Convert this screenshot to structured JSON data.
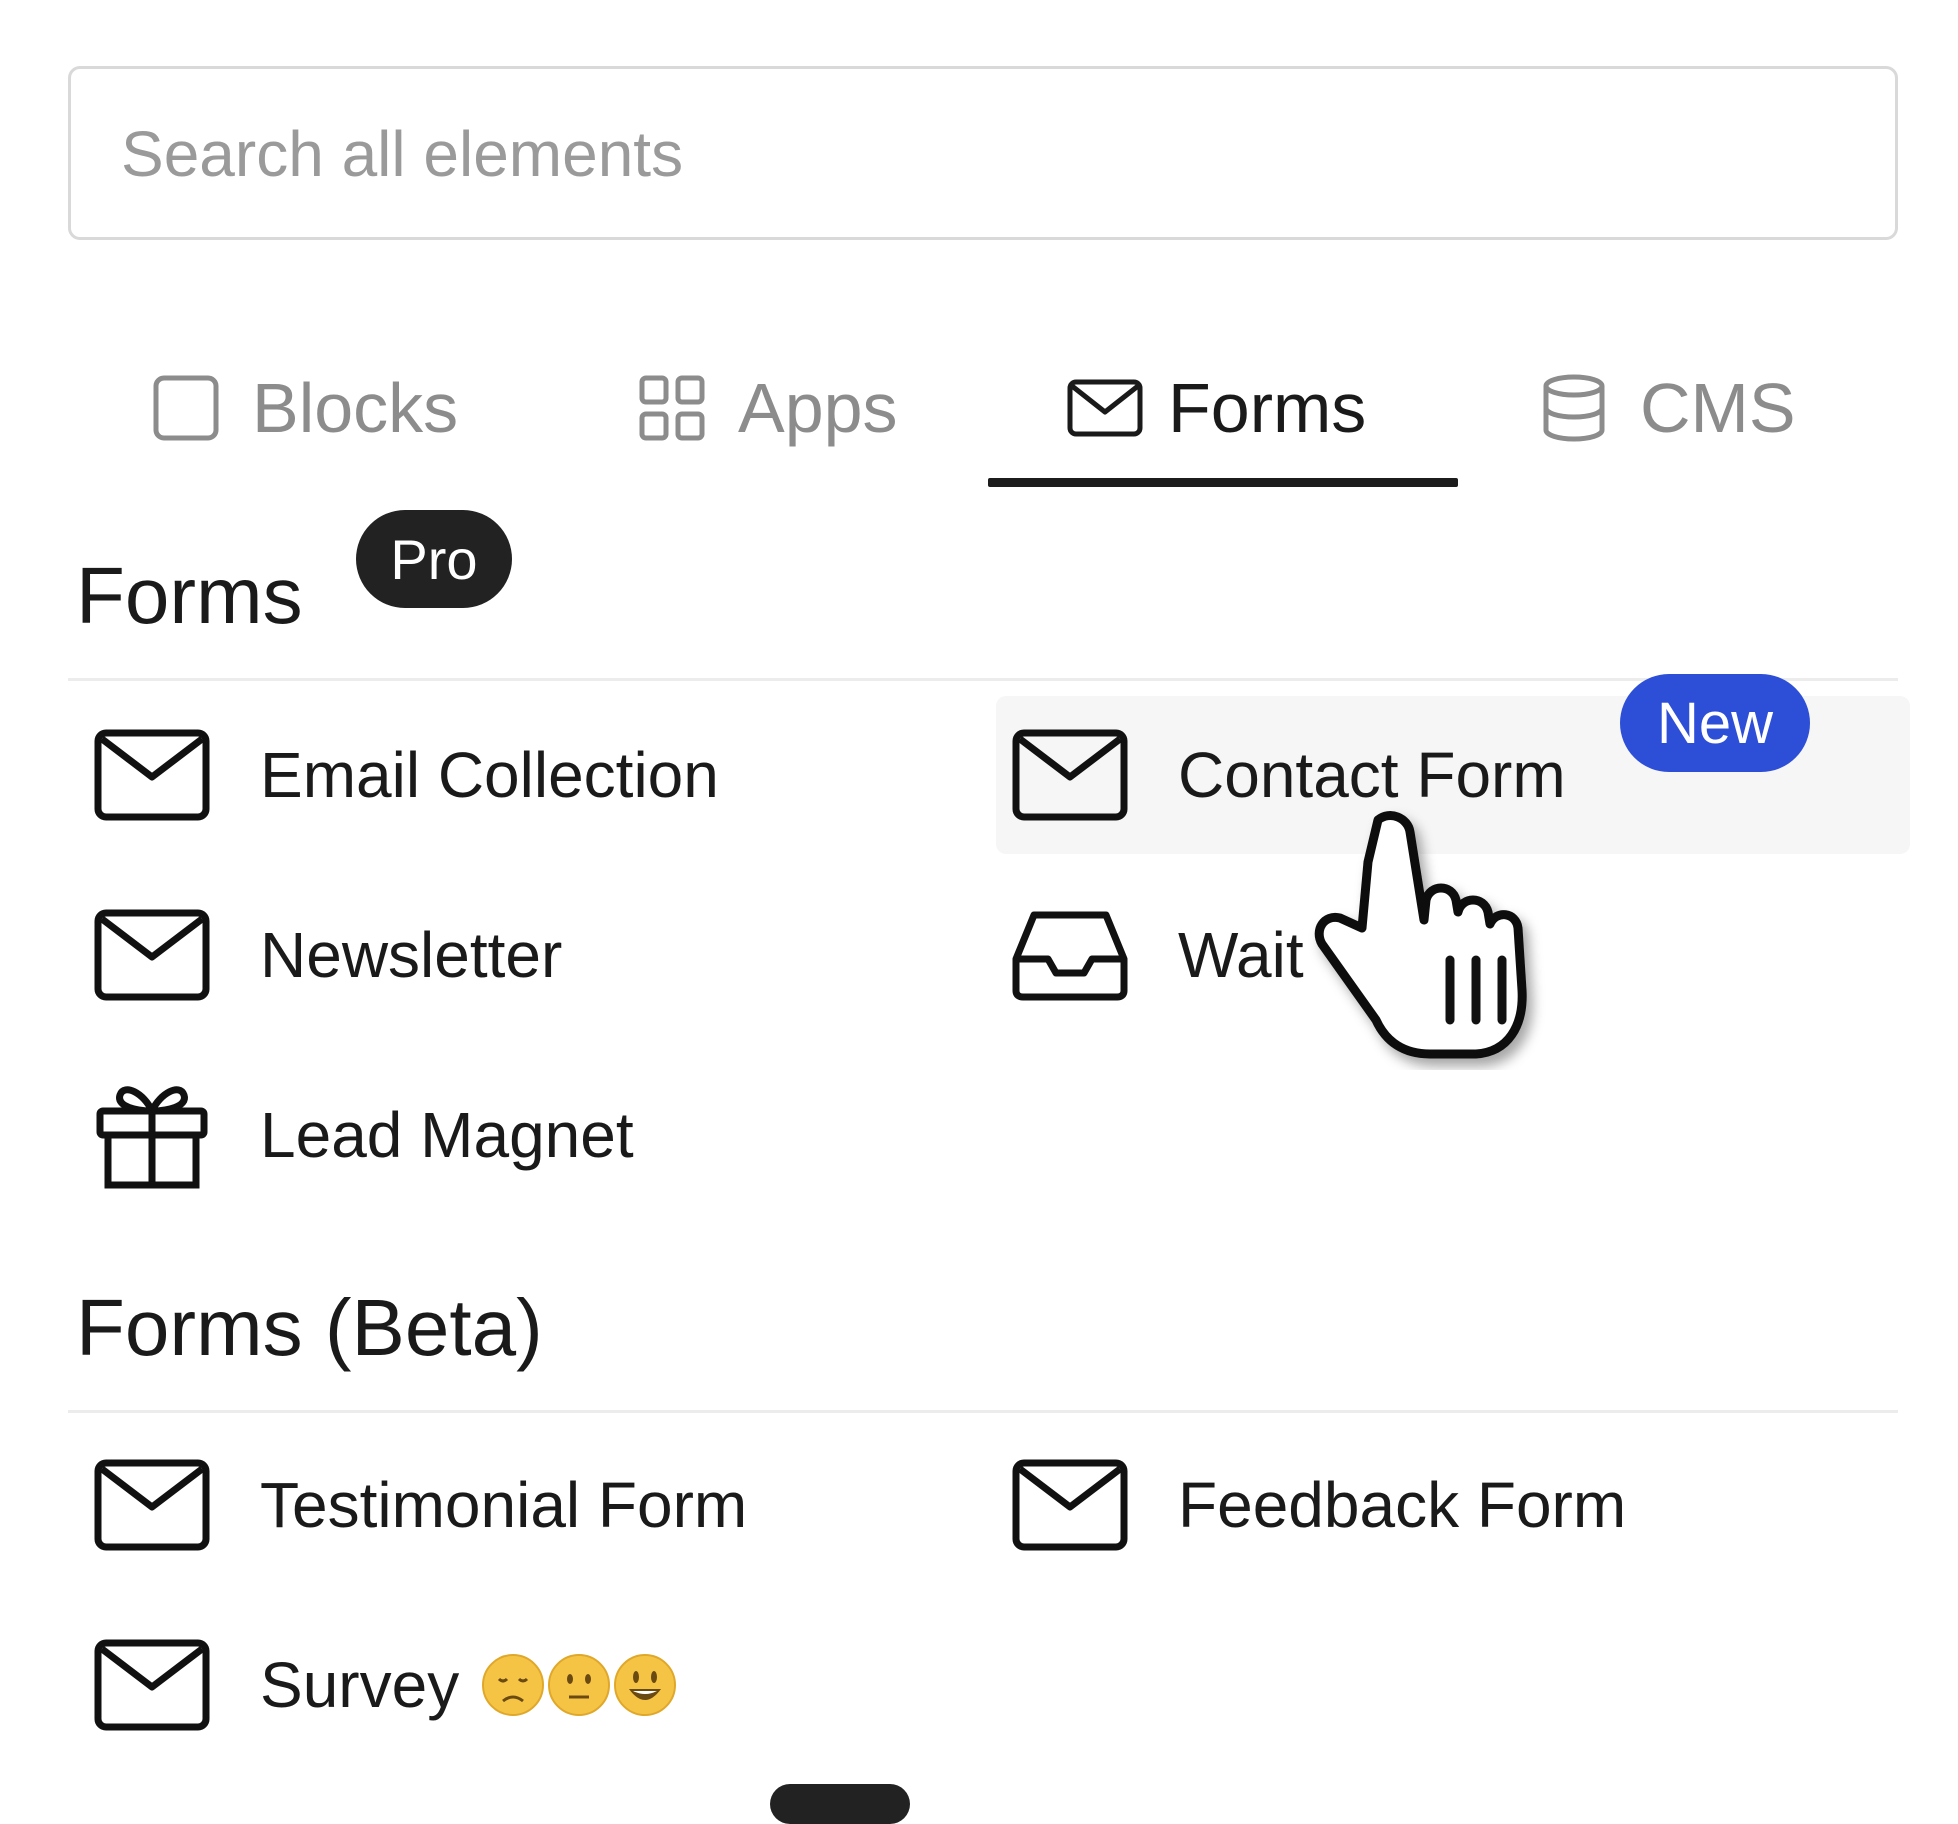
{
  "search": {
    "placeholder": "Search all elements"
  },
  "tabs": [
    {
      "label": "Blocks",
      "icon": "square-icon",
      "active": false
    },
    {
      "label": "Apps",
      "icon": "grid-icon",
      "active": false
    },
    {
      "label": "Forms",
      "icon": "envelope-icon",
      "active": true
    },
    {
      "label": "CMS",
      "icon": "database-icon",
      "active": false
    }
  ],
  "sections": [
    {
      "title": "Forms",
      "badge": "Pro",
      "items": [
        {
          "label": "Email Collection",
          "icon": "envelope-icon"
        },
        {
          "label": "Contact Form",
          "icon": "envelope-icon",
          "badge": "New",
          "hovered": true
        },
        {
          "label": "Newsletter",
          "icon": "envelope-icon"
        },
        {
          "label": "Wait",
          "icon": "inbox-icon"
        },
        {
          "label": "Lead Magnet",
          "icon": "gift-icon"
        }
      ]
    },
    {
      "title": "Forms (Beta)",
      "items": [
        {
          "label": "Testimonial Form",
          "icon": "envelope-icon"
        },
        {
          "label": "Feedback Form",
          "icon": "envelope-icon"
        },
        {
          "label": "Survey",
          "icon": "envelope-icon",
          "emoji": [
            "sad-face-icon",
            "neutral-face-icon",
            "smiling-face-icon"
          ]
        }
      ]
    }
  ],
  "colors": {
    "new_badge": "#2d4fd8",
    "pro_badge": "#222222",
    "active_tab_underline": "#1c1c1c",
    "inactive_tab_text": "#8c8c8c"
  }
}
